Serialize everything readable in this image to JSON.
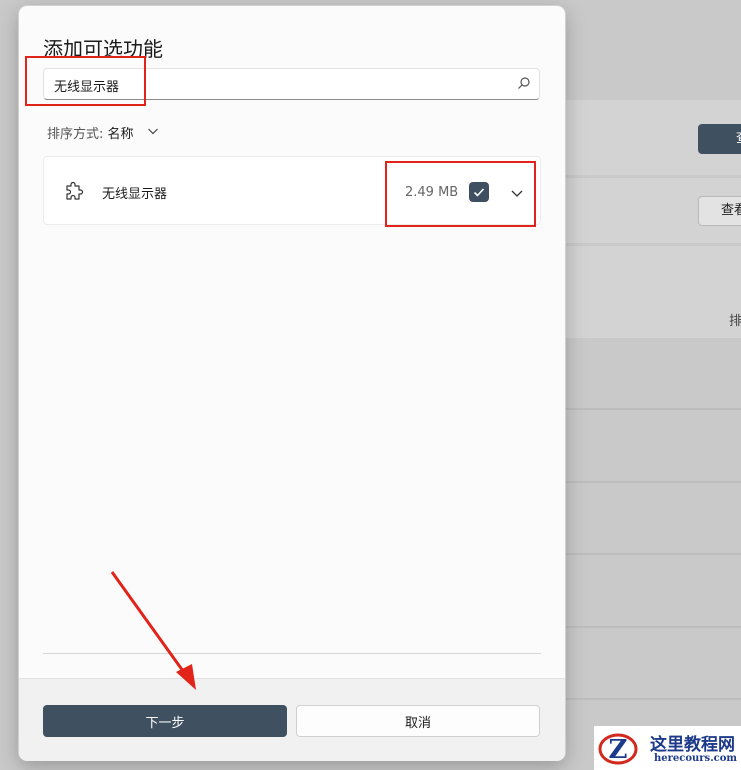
{
  "background": {
    "button_dark_label": "查",
    "button_light_label": "查看",
    "sort_fragment": "排"
  },
  "dialog": {
    "title": "添加可选功能",
    "search": {
      "value": "无线显示器",
      "icon": "search-icon"
    },
    "sort": {
      "label": "排序方式: ",
      "value": "名称"
    },
    "items": [
      {
        "name": "无线显示器",
        "size": "2.49 MB",
        "checked": true,
        "icon": "puzzle-icon"
      }
    ],
    "footer": {
      "next_label": "下一步",
      "cancel_label": "取消"
    }
  },
  "watermark": {
    "cn": "这里教程网",
    "en": "herecours.com",
    "logo_letter": "Z"
  },
  "colors": {
    "accent": "#3f5060",
    "annotation_red": "#e2231a",
    "watermark_blue": "#1d3a8a"
  }
}
